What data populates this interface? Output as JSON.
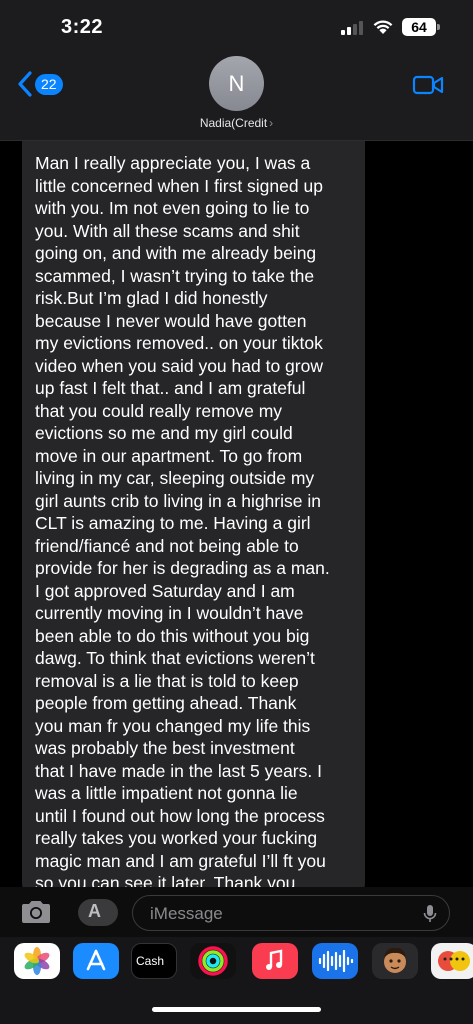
{
  "status_bar": {
    "time": "3:22",
    "battery_level": "64"
  },
  "header": {
    "back_count": "22",
    "avatar_initial": "N",
    "contact_name": "Nadia(Credit",
    "chevron": "›"
  },
  "message": {
    "lines": [
      "Man I really appreciate you, I was a",
      "little concerned when I first signed up",
      "with you. Im not even going to lie to",
      "you. With all these scams and shit",
      "going on, and with me already being",
      "scammed, I wasn’t trying to take the",
      "risk.But I’m glad I did honestly",
      "because I never would have gotten",
      "my evictions removed.. on your tiktok",
      "video when you said you had to grow",
      "up fast I felt that.. and I am grateful",
      "that you could really remove my",
      "evictions so me and my girl could",
      "move in our apartment. To go from",
      "living in my car, sleeping outside my",
      "girl aunts crib to living in a highrise in",
      "CLT is amazing to me. Having a girl",
      "friend/fiancé and not being able to",
      "provide for her is degrading as a man.",
      "I got approved Saturday and I am",
      "currently moving in I wouldn’t have",
      "been able to do this without you big",
      "dawg. To think that evictions weren’t",
      "removal is a lie that is told to keep",
      "people from getting ahead. Thank",
      "you man fr you changed my life this",
      "was probably the best investment",
      "that I have made in the last 5 years. I",
      "was a little impatient not gonna lie",
      "until I found out how long the process",
      "really takes you worked your fucking",
      "magic man and I am grateful I’ll ft you",
      "so you can see it later. Thank you"
    ]
  },
  "input_bar": {
    "placeholder": "iMessage"
  },
  "app_drawer": {
    "apps": [
      {
        "name": "photos-app",
        "color": "#ffffff"
      },
      {
        "name": "app-store-app",
        "color": "#1a8cff"
      },
      {
        "name": "apple-cash-app",
        "color": "#000000",
        "label": "Cash"
      },
      {
        "name": "fitness-app",
        "color": "#111111"
      },
      {
        "name": "music-app",
        "color": "#fa3c50"
      },
      {
        "name": "audio-message-app",
        "color": "#1a73e8"
      },
      {
        "name": "memoji-app",
        "color": "#2a2a2c"
      },
      {
        "name": "stickers-app",
        "color": "#f2f2f2"
      }
    ]
  },
  "colors": {
    "accent": "#0a84ff",
    "bubble": "#262628",
    "header": "#1c1c1e"
  }
}
